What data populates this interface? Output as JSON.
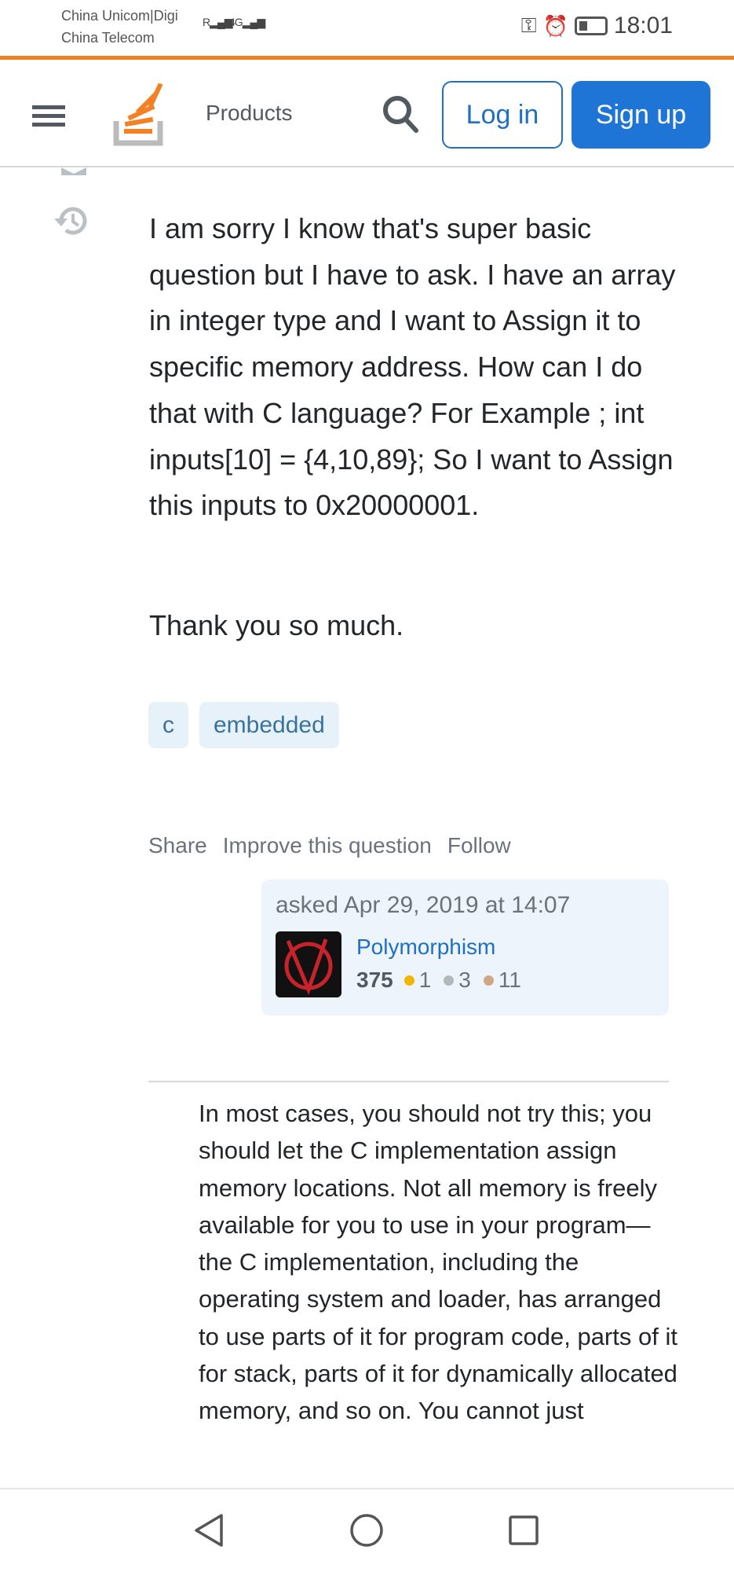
{
  "status_bar": {
    "carrier1": "China Unicom|Digi",
    "carrier2": "China Telecom",
    "signal1": "R",
    "signal2": "4G",
    "time": "18:01"
  },
  "header": {
    "products": "Products",
    "login": "Log in",
    "signup": "Sign up",
    "accent": "#f48024",
    "brand_blue": "#1f75d6"
  },
  "question": {
    "body": "I am sorry I know that's super basic question but I have to ask. I have an array in integer type and I want to Assign it to specific memory address. How can I do that with C language? For Example ; int inputs[10] = {4,10,89}; So I want to Assign this inputs to 0x20000001.",
    "thanks": "Thank you so much.",
    "tags": [
      "c",
      "embedded"
    ],
    "actions": {
      "share": "Share",
      "improve": "Improve this question",
      "follow": "Follow"
    },
    "asked": "asked Apr 29, 2019 at 14:07",
    "user": {
      "name": "Polymorphism",
      "reputation": "375",
      "gold": "1",
      "silver": "3",
      "bronze": "11"
    }
  },
  "answer": {
    "body": "In most cases, you should not try this; you should let the C implementation assign memory locations. Not all memory is freely available for you to use in your program—the C implementation, including the operating system and loader, has arranged to use parts of it for program code, parts of it for stack, parts of it for dynamically allocated memory, and so on. You cannot just"
  }
}
